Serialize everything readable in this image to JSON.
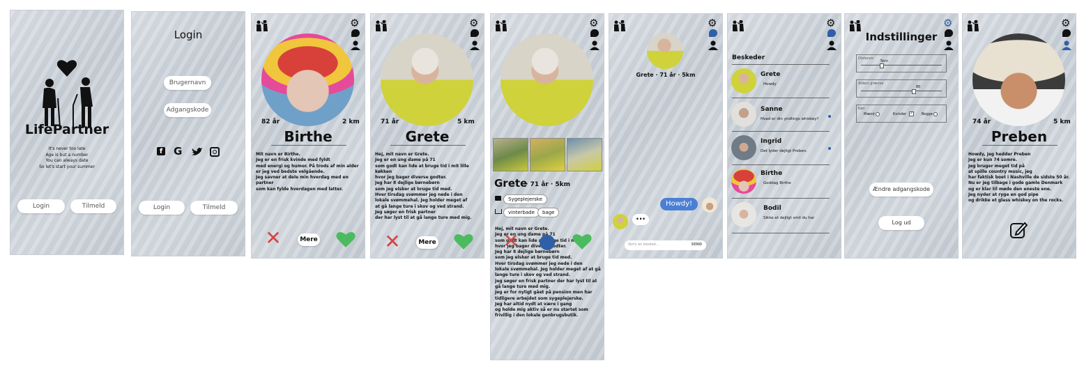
{
  "screens": {
    "splash": {
      "app_name": "LifePartner",
      "tagline": [
        "It's never too late",
        "Age is but a number",
        "You can always date",
        "So let's start your summer"
      ],
      "login_button": "Login",
      "signup_button": "Tilmeld"
    },
    "login": {
      "title": "Login",
      "username_placeholder": "Brugernavn",
      "password_placeholder": "Adgangskode",
      "social_icons": [
        "facebook-icon",
        "google-icon",
        "twitter-icon",
        "instagram-icon"
      ],
      "login_button": "Login",
      "signup_button": "Tilmeld"
    },
    "profile_birthe": {
      "age": "82 år",
      "distance": "2 km",
      "name": "Birthe",
      "bio": [
        "Mit navn er Birthe.",
        "Jeg er en frisk kvinde med fyldt",
        "med energi og humor. På trods af min alder",
        "er jeg ved bedste velgående.",
        "Jeg savner at dele min hverdag med en partner",
        "som kan fylde hverdagen med latter."
      ],
      "more_button": "Mere"
    },
    "profile_grete": {
      "age": "71 år",
      "distance": "5 km",
      "name": "Grete",
      "bio": [
        "Hej, mit navn er Grete.",
        "Jeg er en ung dame på 71",
        "som godt kan lide at bruge tid i mit lille køkken",
        "hvor jeg bager diverse godter.",
        "Jeg har 8 dejlige børnebørn",
        "som jeg elsker at bruge tid med.",
        "Hver tirsdag svømmer jeg nede i den",
        "lokale svømmehal. Jeg holder meget af",
        "at gå lange ture i skov og ved strand.",
        "Jeg søger en frisk partner",
        "der har lyst til at gå lange ture med mig."
      ],
      "more_button": "Mere"
    },
    "profile_grete_detail": {
      "header": "Grete",
      "header_meta": "· 71 år · 5km",
      "job_tag": "Sygeplejerske",
      "hobby_tags": [
        "vinterbade",
        "bage"
      ],
      "bio": [
        "Hej, mit navn er Grete.",
        "Jeg er en ung dame på 71",
        "som godt kan lide at bruge tid i mit lille",
        "hvor jeg bager diverse godter.",
        "Jeg har 8 dejlige børnebørn",
        "som jeg elsker at bruge tid med.",
        "Hver tirsdag svømmer jeg nede i den",
        "lokale svømmehal. Jeg holder meget af at gå",
        "lange ture i skov og ved strand.",
        "Jeg søger en frisk partner der har lyst til at",
        "gå lange ture med mig.",
        "Jeg er for nyligt gået på pension men har",
        "tidligere arbejdet som sygeplejerske.",
        "Jeg har altid nydt at være i gang",
        "og holde mig aktiv så er nu startet som",
        "frivillig i den lokale genbrugsbutik."
      ]
    },
    "chat": {
      "contact_label": "Grete · 71 år · 5km",
      "sent_message": "Howdy!",
      "typing_indicator": "···",
      "input_placeholder": "Skriv en besked...",
      "send_button": "SEND"
    },
    "messages": {
      "title": "Beskeder",
      "conversations": [
        {
          "name": "Grete",
          "preview": "Howdy",
          "unread": false
        },
        {
          "name": "Sanne",
          "preview": "Hvad er din yndlings whiskey?",
          "unread": true
        },
        {
          "name": "Ingrid",
          "preview": "Det lyder dejligt Preben.",
          "unread": true
        },
        {
          "name": "Birthe",
          "preview": "Goddag Birthe",
          "unread": false
        },
        {
          "name": "Bodil",
          "preview": "Sikke et dejligt smil du har",
          "unread": false
        }
      ]
    },
    "settings": {
      "title": "Indstillinger",
      "distance_label": "Distance",
      "distance_value": "5km",
      "distance_level": 0.25,
      "age_label": "Alders grænse",
      "age_value": "80",
      "age_level": 0.65,
      "gender_label": "Køn",
      "gender_options": [
        {
          "label": "Mænd",
          "checked": false
        },
        {
          "label": "Kvinder",
          "checked": true
        },
        {
          "label": "Begge",
          "checked": false
        }
      ],
      "change_password_button": "Ændre adgangskode",
      "logout_button": "Log ud"
    },
    "my_profile": {
      "age": "74 år",
      "distance": "5 km",
      "name": "Preben",
      "bio": [
        "Howdy, jeg hedder Preben",
        "Jeg er kun 74 somre.",
        "Jeg bruger meget tid på",
        "at spille country music, jeg",
        "har faktisk boet i Nashville de sidste 50 år.",
        "Nu er jeg tilbage i gode gamle Denmark",
        "og er klar til møde den eneste ene.",
        "Jeg nyder at ryge en god pipe",
        "og drikke et glass whiskey on the rocks."
      ]
    }
  },
  "colors": {
    "like": "#4cbb5f",
    "dislike": "#d64545",
    "accent": "#2f5fa8",
    "chat_bubble": "#4a7fd4"
  },
  "icons": {
    "logo": "elderly-couple-icon",
    "settings": "gear-icon",
    "messages": "chat-bubble-icon",
    "profile": "person-icon",
    "edit": "edit-icon"
  }
}
